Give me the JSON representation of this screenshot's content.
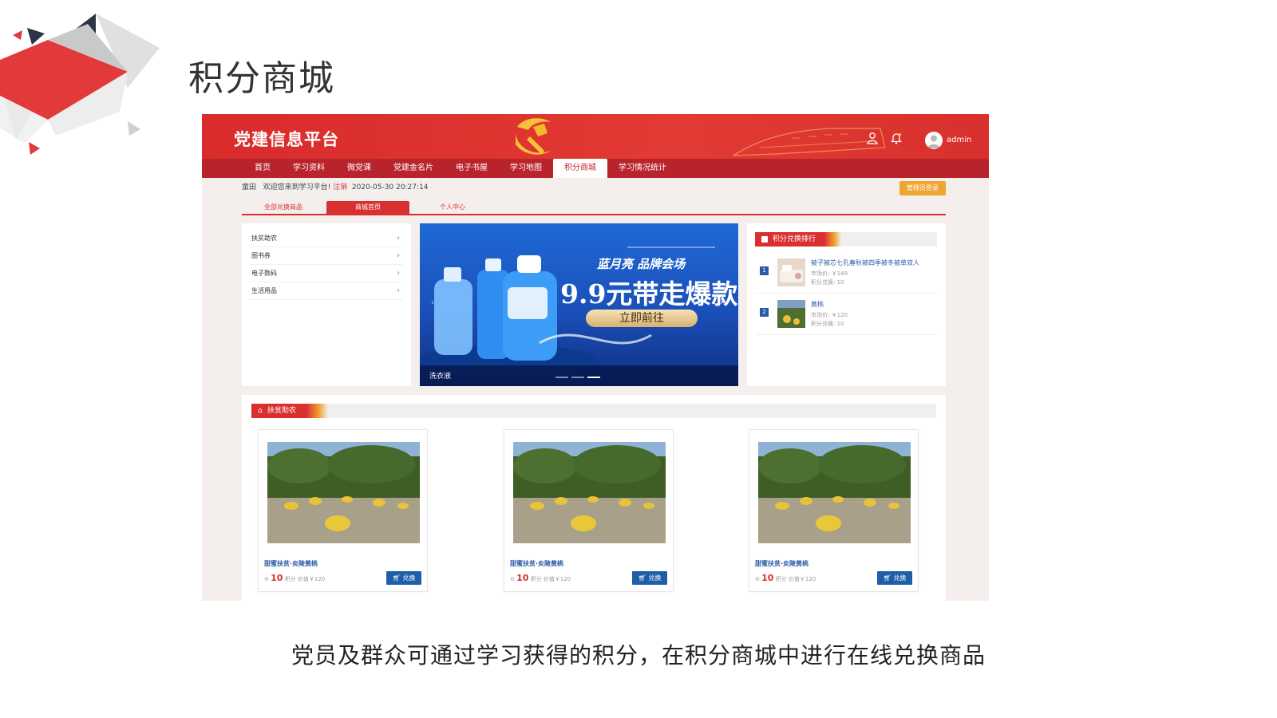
{
  "slide": {
    "title": "积分商城",
    "caption": "党员及群众可通过学习获得的积分，在积分商城中进行在线兑换商品"
  },
  "app": {
    "brand": "党建信息平台",
    "user": "admin",
    "nav": [
      "首页",
      "学习资料",
      "微党课",
      "党建金名片",
      "电子书屋",
      "学习地图",
      "积分商城",
      "学习情况统计"
    ],
    "nav_active": "积分商城",
    "welcome": {
      "location": "童田",
      "message": "欢迎您来到学习平台!",
      "logout": "注销",
      "datetime": "2020-05-30 20:27:14"
    },
    "admin_login": "管理员登录",
    "subtabs": [
      "全部兑换商品",
      "商城首页",
      "个人中心"
    ],
    "subtab_active": "商城首页",
    "categories": [
      "扶贫助农",
      "图书券",
      "电子数码",
      "生活用品"
    ],
    "banner": {
      "brand": "蓝月亮 品牌会场",
      "headline": "9.9元带走爆款",
      "cta": "立即前往",
      "caption": "洗衣液",
      "slide_count": 3,
      "active_slide": 3
    },
    "ranking": {
      "title": "积分兑换排行",
      "items": [
        {
          "rank": "1",
          "name": "被子被芯七孔春秋被四季被冬被单双人",
          "market": "市场价: ￥149",
          "points": "积分兑换: 10"
        },
        {
          "rank": "2",
          "name": "黄桃",
          "market": "市场价: ￥120",
          "points": "积分兑换: 10"
        }
      ]
    },
    "products": {
      "section_title": "扶贫助农",
      "items": [
        {
          "name": "甜蜜扶贫·炎陵黄桃",
          "points": "10",
          "unit": "积分",
          "value": "价值￥120",
          "button": "兑换"
        },
        {
          "name": "甜蜜扶贫·炎陵黄桃",
          "points": "10",
          "unit": "积分",
          "value": "价值￥120",
          "button": "兑换"
        },
        {
          "name": "甜蜜扶贫·炎陵黄桃",
          "points": "10",
          "unit": "积分",
          "value": "价值￥120",
          "button": "兑换"
        }
      ]
    }
  },
  "colors": {
    "header_red": "#d92b2b",
    "nav_red": "#b9232b",
    "accent_red": "#d9302f",
    "link_blue": "#2a5aa6",
    "button_blue": "#1f5ea8",
    "admin_orange": "#f1a531"
  },
  "icons": [
    "user-icon",
    "bell-icon",
    "avatar-icon",
    "chevron-right-icon",
    "cart-icon",
    "home-icon",
    "coin-icon",
    "trophy-icon"
  ]
}
